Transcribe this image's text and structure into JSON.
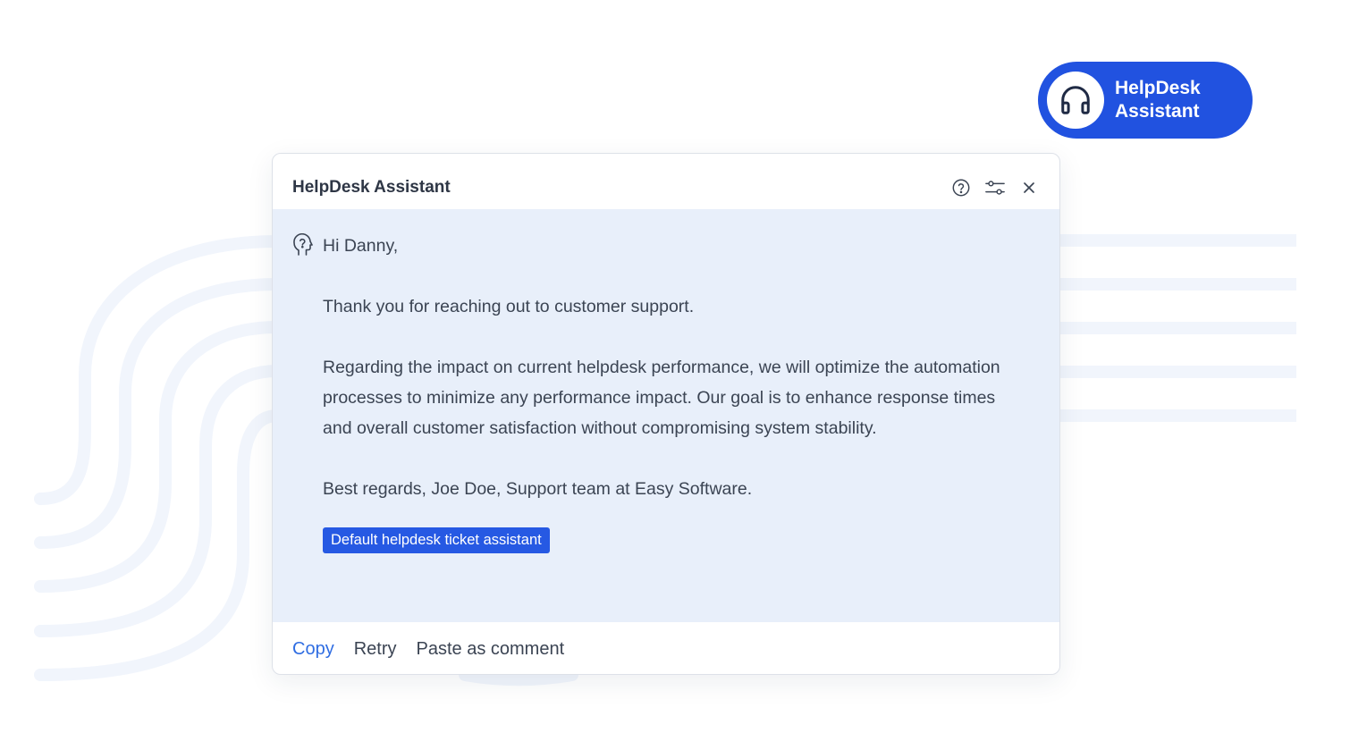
{
  "launcher": {
    "icon": "headphones-icon",
    "label": "HelpDesk Assistant",
    "color": "#2152e0"
  },
  "panel": {
    "title": "HelpDesk Assistant",
    "header_icons": [
      "help-circle-icon",
      "sliders-icon",
      "close-icon"
    ]
  },
  "message": {
    "bot_icon": "head-question-icon",
    "greeting": "Hi Danny,",
    "paragraphs": [
      "Thank you for reaching out to customer support.",
      "Regarding the impact on current helpdesk performance, we will optimize the automation processes to minimize any performance impact. Our goal is to enhance response times and overall customer satisfaction without compromising system stability.",
      "Best regards, Joe Doe, Support team at Easy Software."
    ],
    "tag": "Default helpdesk ticket assistant",
    "background": "#e8effa"
  },
  "footer": {
    "copy": "Copy",
    "retry": "Retry",
    "paste": "Paste as comment",
    "accent": "#2f6de2"
  }
}
